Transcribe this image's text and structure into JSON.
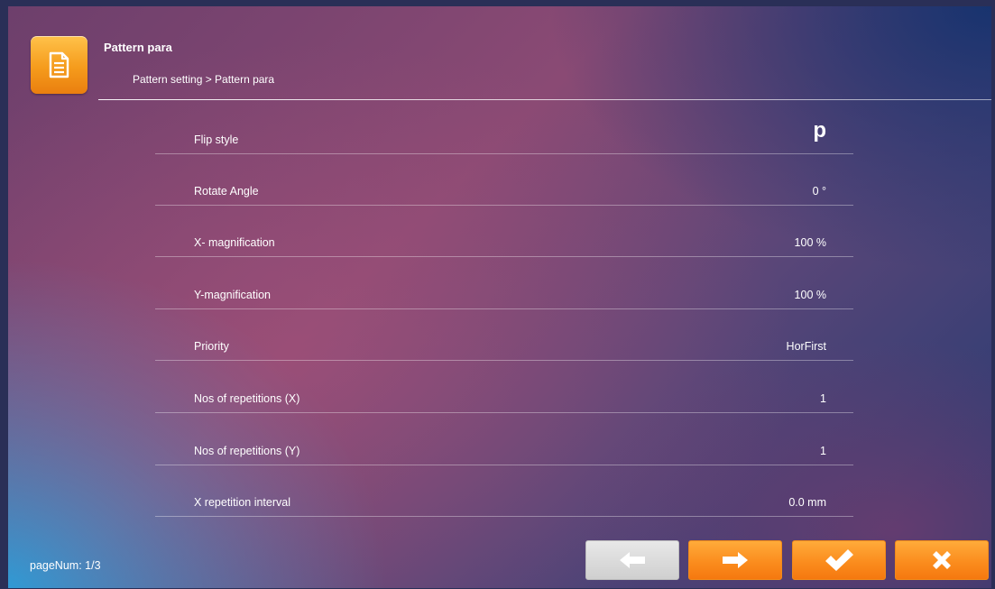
{
  "header": {
    "title": "Pattern para",
    "breadcrumb": "Pattern setting > Pattern para",
    "icon": "document-icon",
    "accent_color": "#f7a21f"
  },
  "params": [
    {
      "label": "Flip style",
      "value": "p"
    },
    {
      "label": "Rotate Angle",
      "value": "0 °"
    },
    {
      "label": "X- magnification",
      "value": "100 %"
    },
    {
      "label": "Y-magnification",
      "value": "100 %"
    },
    {
      "label": "Priority",
      "value": "HorFirst"
    },
    {
      "label": "Nos of repetitions (X)",
      "value": "1"
    },
    {
      "label": "Nos of repetitions (Y)",
      "value": "1"
    },
    {
      "label": "X repetition interval",
      "value": "0.0 mm"
    }
  ],
  "footer": {
    "page_num": "pageNum: 1/3",
    "buttons": {
      "prev": {
        "icon": "arrow-left-icon",
        "enabled": false
      },
      "next": {
        "icon": "arrow-right-icon",
        "enabled": true
      },
      "confirm": {
        "icon": "checkmark-icon",
        "enabled": true
      },
      "cancel": {
        "icon": "close-icon",
        "enabled": true
      }
    }
  }
}
